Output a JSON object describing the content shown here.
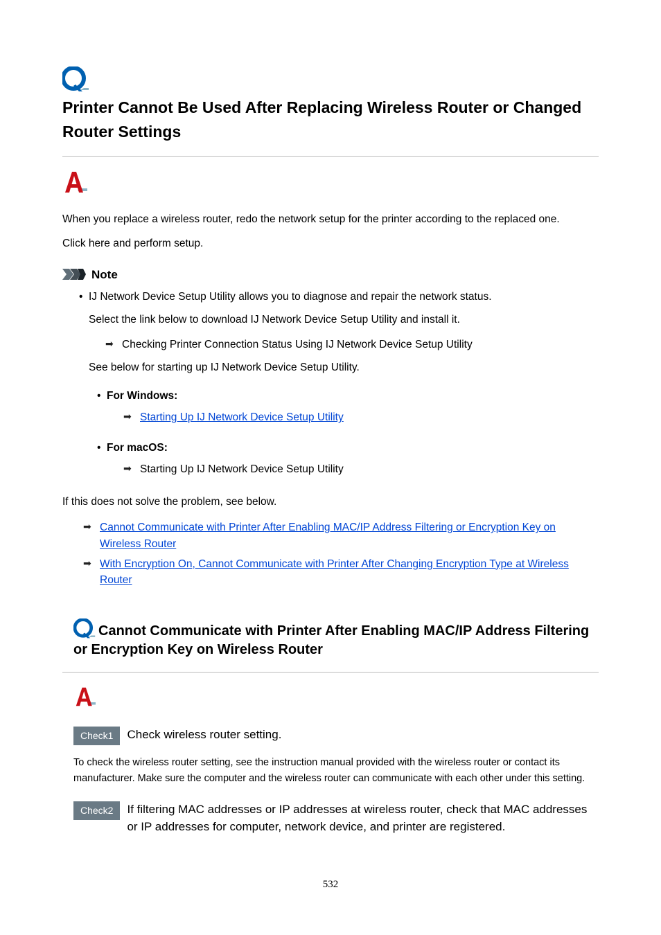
{
  "heading": "Printer Cannot Be Used After Replacing Wireless Router or Changed Router Settings",
  "intro1": "When you replace a wireless router, redo the network setup for the printer according to the replaced one.",
  "intro2": "Click here and perform setup.",
  "note_label": "Note",
  "note_bullet": "IJ Network Device Setup Utility allows you to diagnose and repair the network status.",
  "note_sub1": "Select the link below to download IJ Network Device Setup Utility and install it.",
  "note_arrow1": "Checking Printer Connection Status Using IJ Network Device Setup Utility",
  "note_sub2": "See below for starting up IJ Network Device Setup Utility.",
  "os_windows": "For Windows:",
  "os_windows_link": "Starting Up IJ Network Device Setup Utility",
  "os_mac": "For macOS:",
  "os_mac_text": "Starting Up IJ Network Device Setup Utility",
  "post_note": "If this does not solve the problem, see below.",
  "link1": "Cannot Communicate with Printer After Enabling MAC/IP Address Filtering or Encryption Key on Wireless Router",
  "link2": "With Encryption On, Cannot Communicate with Printer After Changing Encryption Type at Wireless Router",
  "sub_title": "Cannot Communicate with Printer After Enabling MAC/IP Address Filtering or Encryption Key on Wireless Router",
  "check1_label": "Check1",
  "check1_text": "Check wireless router setting.",
  "check1_explain": "To check the wireless router setting, see the instruction manual provided with the wireless router or contact its manufacturer. Make sure the computer and the wireless router can communicate with each other under this setting.",
  "check2_label": "Check2",
  "check2_text": "If filtering MAC addresses or IP addresses at wireless router, check that MAC addresses or IP addresses for computer, network device, and printer are registered.",
  "page_number": "532"
}
